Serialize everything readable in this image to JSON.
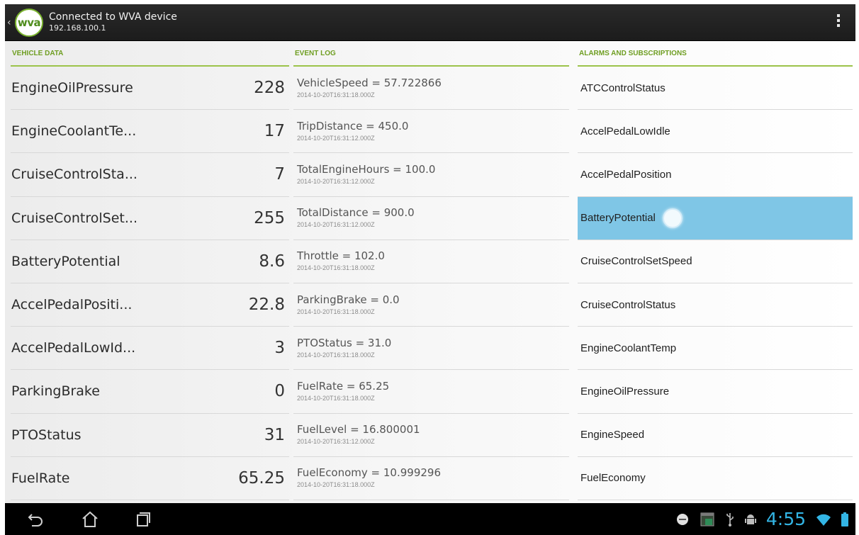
{
  "actionbar": {
    "title": "Connected to WVA device",
    "subtitle": "192.168.100.1",
    "logo_text": "wva",
    "up_icon": "chevron-left-icon",
    "overflow_icon": "overflow-menu-icon"
  },
  "columns": {
    "vehicle_header": "VEHICLE DATA",
    "log_header": "EVENT LOG",
    "alarms_header": "ALARMS AND SUBSCRIPTIONS"
  },
  "vehicle_data": [
    {
      "name": "EngineOilPressure",
      "value": "228"
    },
    {
      "name": "EngineCoolantTe...",
      "value": "17"
    },
    {
      "name": "CruiseControlSta...",
      "value": "7"
    },
    {
      "name": "CruiseControlSet...",
      "value": "255"
    },
    {
      "name": "BatteryPotential",
      "value": "8.6"
    },
    {
      "name": "AccelPedalPositi...",
      "value": "22.8"
    },
    {
      "name": "AccelPedalLowId...",
      "value": "3"
    },
    {
      "name": "ParkingBrake",
      "value": "0"
    },
    {
      "name": "PTOStatus",
      "value": "31"
    },
    {
      "name": "FuelRate",
      "value": "65.25"
    }
  ],
  "event_log": [
    {
      "event": "VehicleSpeed = 57.722866",
      "timestamp": "2014-10-20T16:31:18.000Z"
    },
    {
      "event": "TripDistance = 450.0",
      "timestamp": "2014-10-20T16:31:12.000Z"
    },
    {
      "event": "TotalEngineHours = 100.0",
      "timestamp": "2014-10-20T16:31:12.000Z"
    },
    {
      "event": "TotalDistance = 900.0",
      "timestamp": "2014-10-20T16:31:12.000Z"
    },
    {
      "event": "Throttle = 102.0",
      "timestamp": "2014-10-20T16:31:18.000Z"
    },
    {
      "event": "ParkingBrake = 0.0",
      "timestamp": "2014-10-20T16:31:18.000Z"
    },
    {
      "event": "PTOStatus = 31.0",
      "timestamp": "2014-10-20T16:31:18.000Z"
    },
    {
      "event": "FuelRate = 65.25",
      "timestamp": "2014-10-20T16:31:18.000Z"
    },
    {
      "event": "FuelLevel = 16.800001",
      "timestamp": "2014-10-20T16:31:12.000Z"
    },
    {
      "event": "FuelEconomy = 10.999296",
      "timestamp": "2014-10-20T16:31:18.000Z"
    }
  ],
  "alarms": [
    {
      "name": "ATCControlStatus",
      "selected": false
    },
    {
      "name": "AccelPedalLowIdle",
      "selected": false
    },
    {
      "name": "AccelPedalPosition",
      "selected": false
    },
    {
      "name": "BatteryPotential",
      "selected": true
    },
    {
      "name": "CruiseControlSetSpeed",
      "selected": false
    },
    {
      "name": "CruiseControlStatus",
      "selected": false
    },
    {
      "name": "EngineCoolantTemp",
      "selected": false
    },
    {
      "name": "EngineOilPressure",
      "selected": false
    },
    {
      "name": "EngineSpeed",
      "selected": false
    },
    {
      "name": "FuelEconomy",
      "selected": false
    }
  ],
  "navbar": {
    "back_icon": "back-icon",
    "home_icon": "home-icon",
    "recents_icon": "recent-apps-icon",
    "clock": "4:55"
  },
  "colors": {
    "accent_green": "#6f9e22",
    "selection_blue": "#7fc6e6",
    "clock_blue": "#33b5e5",
    "actionbar_bg": "#222222"
  }
}
